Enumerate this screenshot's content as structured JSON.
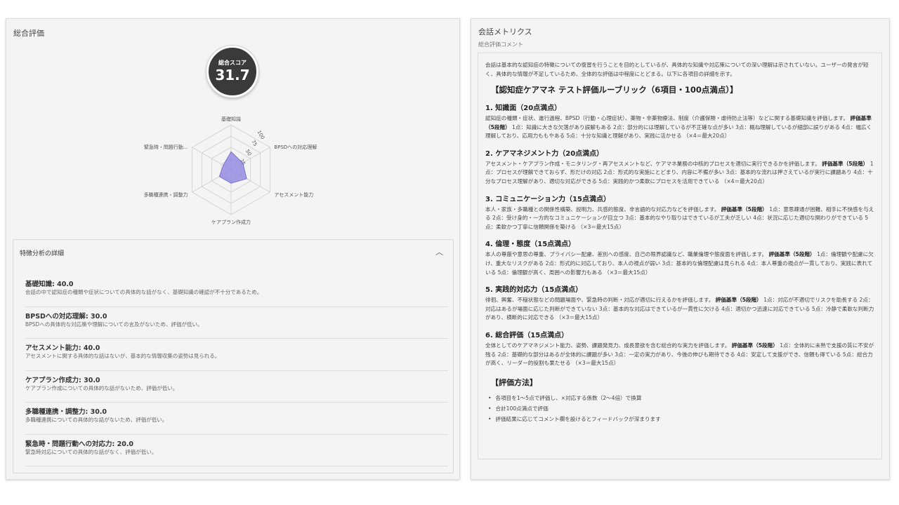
{
  "left_panel": {
    "title": "総合評価",
    "score": {
      "label": "総合スコア",
      "value": "31.7"
    },
    "radar": {
      "axes": [
        "基礎知識",
        "BPSDへの対応理解",
        "アセスメント能力",
        "ケアプラン作成力",
        "多職種連携・調整力",
        "緊急時・問題行動..."
      ],
      "values": [
        40.0,
        30.0,
        40.0,
        30.0,
        30.0,
        20.0
      ],
      "max": 100,
      "ticks": [
        "25",
        "50",
        "75",
        "100"
      ],
      "fill_color": "#8a80e0"
    },
    "details": {
      "title": "特徴分析の詳細",
      "items": [
        {
          "title": "基礎知識: 40.0",
          "comment": "会話の中で認知症の種類や症状についての具体的な話がなく、基礎知識の確認が不十分であるため。"
        },
        {
          "title": "BPSDへの対応理解: 30.0",
          "comment": "BPSDへの具体的な対応策や理解についての言及がないため、評価が低い。"
        },
        {
          "title": "アセスメント能力: 40.0",
          "comment": "アセスメントに関する具体的な話はないが、基本的な情報収集の姿勢は見られる。"
        },
        {
          "title": "ケアプラン作成力: 30.0",
          "comment": "ケアプラン作成についての具体的な話がないため、評価が低い。"
        },
        {
          "title": "多職種連携・調整力: 30.0",
          "comment": "多職種連携についての具体的な話がないため、評価が低い。"
        },
        {
          "title": "緊急時・問題行動への対応力: 20.0",
          "comment": "緊急時対応についての具体的な話がなく、評価が低い。"
        }
      ]
    }
  },
  "right_panel": {
    "title": "会話メトリクス",
    "subtitle": "総合評価コメント",
    "intro": "会話は基本的な認知症の特徴についての復習を行うことを目的としているが、具体的な知識や対応策についての深い理解は示されていない。ユーザーの発言が短く、具体的な情報が不足しているため、全体的な評価は中程度にとどまる。以下に各項目の詳細を示す。",
    "rubric_title": "【認知症ケアマネ テスト評価ルーブリック（6項目・100点満点）】",
    "sections": [
      {
        "heading": "1. 知識面（20点満点）",
        "desc": "認知症の種類・症状、進行過程、BPSD（行動・心理症状）、薬物・非薬物療法、制度（介護保険・虐待防止法等）などに関する基礎知識を評価します。",
        "criteria_label": "評価基準（5段階）",
        "criteria": "1点：知識に大きな欠落があり誤解もある 2点：部分的には理解しているが不正確な点が多い 3点：概ね理解しているが細部に誤りがある 4点：幅広く理解しており、応用力ももやある 5点：十分な知識と理解があり、実践に活かせる （×4＝最大20点）"
      },
      {
        "heading": "2. ケアマネジメント力（20点満点）",
        "desc": "アセスメント・ケアプラン作成・モニタリング・再アセスメントなど、ケアマネ業務の中核的プロセスを適切に実行できるかを評価します。",
        "criteria_label": "評価基準（5段階）",
        "criteria": "1点：プロセスが理解できておらず、形だけの対応 2点：形式的な実施にとどまり、内容に不備が多い 3点：基本的な流れは押さえているが実行に課題あり 4点：十分なプロセス理解があり、適切な対応ができる 5点：実践的かつ柔軟にプロセスを活用できている （×4＝最大20点）"
      },
      {
        "heading": "3. コミュニケーション力（15点満点）",
        "desc": "本人・家族・多職種との関係性構築、説明力、共感的態度、非言語的な対応力などを評価します。",
        "criteria_label": "評価基準（5段階）",
        "criteria": "1点：意思疎通が困難、相手に不快感を与える 2点：受け身的・一方的なコミュニケーションが目立つ 3点：基本的なやり取りはできているが工夫が乏しい 4点：状況に応じた適切な関わりができている 5点：柔軟かつ丁寧に信頼関係を築ける （×3＝最大15点）"
      },
      {
        "heading": "4. 倫理・態度（15点満点）",
        "desc": "本人の尊厳や意思の尊重、プライバシー配慮、差別への感度、自己の限界認識など、職業倫理や態度面を評価します。",
        "criteria_label": "評価基準（5段階）",
        "criteria": "1点：倫理観や配慮に欠け、重大なリスクがある 2点：形式的に対応しており、本人の視点が弱い 3点：基本的な倫理配慮は見られる 4点：本人尊重の視点が一貫しており、実践に表れている 5点：倫理観が高く、周囲への影響力もある （×3＝最大15点）"
      },
      {
        "heading": "5. 実践的対応力（15点満点）",
        "desc": "徘徊、興奮、不穏状態などの問題場面や、緊急時の判断・対応が適切に行えるかを評価します。",
        "criteria_label": "評価基準（5段階）",
        "criteria": "1点：対応が不適切でリスクを助長する 2点：対応はあるが場面に応じた判断ができていない 3点：基本的な対応はできているが一貫性に欠ける 4点：適切かつ迅速に対応できている 5点：冷静で柔軟な判断力があり、横断的に対応できる （×3＝最大15点）"
      },
      {
        "heading": "6. 総合評価（15点満点）",
        "desc": "全体としてのケアマネジメント能力、姿勢、課題発見力、成長意欲を含む総合的な実力を評価します。",
        "criteria_label": "評価基準（5段階）",
        "criteria": "1点：全体的に未熟で支援の質に不安が残る 2点：基礎的な部分はあるが全体的に課題が多い 3点：一定の実力があり、今後の伸びも期待できる 4点：安定して支援ができ、信頼も得ている 5点：総合力が高く、リーダー的役割も果たせる （×3＝最大15点）"
      }
    ],
    "method_title": "【評価方法】",
    "method_items": [
      "各項目を1〜5点で評価し、×対応する係数（2〜4倍）で換算",
      "合計100点満点で評価",
      "評価結果に応じてコメント欄を設けるとフィードバックが深まります"
    ]
  }
}
